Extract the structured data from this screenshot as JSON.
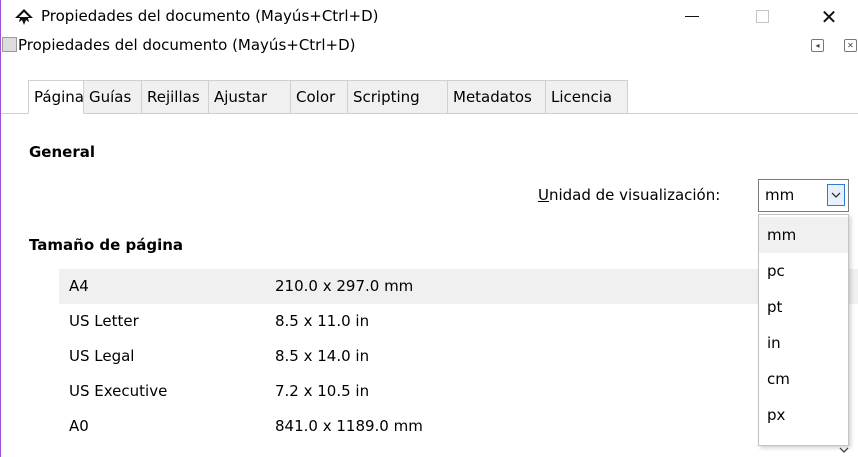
{
  "window": {
    "title": "Propiedades del documento (Mayús+Ctrl+D)",
    "icon": "inkscape-icon",
    "minimize": "minimize-icon",
    "maximize": "maximize-icon",
    "close_glyph": "✕"
  },
  "dock": {
    "title": "Propiedades del documento (Mayús+Ctrl+D)",
    "icon": "dialog-icon",
    "btn_iconify": "◂",
    "btn_close": "✕"
  },
  "tabs": [
    {
      "label": "Página"
    },
    {
      "label": "Guías"
    },
    {
      "label": "Rejillas"
    },
    {
      "label": "Ajustar"
    },
    {
      "label": "Color"
    },
    {
      "label": "Scripting"
    },
    {
      "label": "Metadatos"
    },
    {
      "label": "Licencia"
    }
  ],
  "general": {
    "heading": "General",
    "unit_label_accel": "U",
    "unit_label_rest": "nidad de visualización:",
    "unit_value": "mm",
    "unit_options": [
      "mm",
      "pc",
      "pt",
      "in",
      "cm",
      "px"
    ],
    "highlighted_option": "mm"
  },
  "page_size": {
    "heading": "Tamaño de página",
    "rows": [
      {
        "name": "A4",
        "size": "210.0 x 297.0 mm",
        "selected": true
      },
      {
        "name": "US Letter",
        "size": "8.5 x 11.0 in",
        "selected": false
      },
      {
        "name": "US Legal",
        "size": "8.5 x 14.0 in",
        "selected": false
      },
      {
        "name": "US Executive",
        "size": "7.2 x 10.5 in",
        "selected": false
      },
      {
        "name": "A0",
        "size": "841.0 x 1189.0 mm",
        "selected": false
      }
    ]
  },
  "colors": {
    "window_border": "#a14fd6",
    "selected_row": "#f0f0f0",
    "combo_arrow_border": "#2d7bd6"
  }
}
